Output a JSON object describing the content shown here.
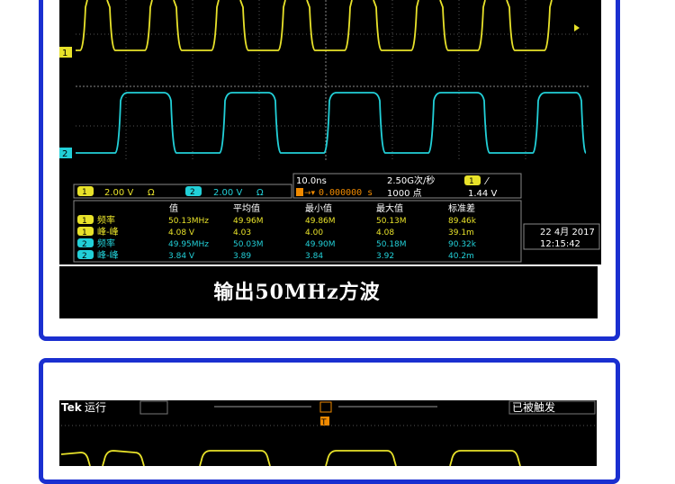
{
  "panel1": {
    "channel_markers": {
      "ch1": "1",
      "ch2": "2"
    },
    "channel_settings": {
      "ch1_badge": "1",
      "ch1_scale": "2.00 V",
      "ch1_coupling": "Ω",
      "ch2_badge": "2",
      "ch2_scale": "2.00 V",
      "ch2_coupling": "Ω"
    },
    "timebase": {
      "time_div": "10.0ns",
      "sample_rate": "2.50G次/秒",
      "trigger_badge": "1",
      "trigger_slope": "⁄",
      "trigger_delay": "0.000000 s",
      "record_length": "1000 点",
      "trigger_level": "1.44 V"
    },
    "measurements": {
      "headers": [
        "值",
        "平均值",
        "最小值",
        "最大值",
        "标准差"
      ],
      "rows": [
        {
          "ch": "1",
          "name": "频率",
          "value": "50.13MHz",
          "mean": "49.96M",
          "min": "49.86M",
          "max": "50.13M",
          "std": "89.46k"
        },
        {
          "ch": "1",
          "name": "峰-峰",
          "value": "4.08 V",
          "mean": "4.03",
          "min": "4.00",
          "max": "4.08",
          "std": "39.1m"
        },
        {
          "ch": "2",
          "name": "频率",
          "value": "49.95MHz",
          "mean": "50.03M",
          "min": "49.90M",
          "max": "50.18M",
          "std": "90.32k"
        },
        {
          "ch": "2",
          "name": "峰-峰",
          "value": "3.84 V",
          "mean": "3.89",
          "min": "3.84",
          "max": "3.92",
          "std": "40.2m"
        }
      ]
    },
    "datetime": {
      "date": "22 4月 2017",
      "time": "12:15:42"
    },
    "caption": "输出50MHz方波"
  },
  "panel2": {
    "brand": "Tek",
    "run_state": "运行",
    "trigger_marker": "T",
    "trigger_status": "已被触发"
  },
  "colors": {
    "border": "#1a2fd0",
    "ch1": "#e8e22a",
    "ch2": "#22d0d8",
    "trigger": "#f08a00"
  }
}
